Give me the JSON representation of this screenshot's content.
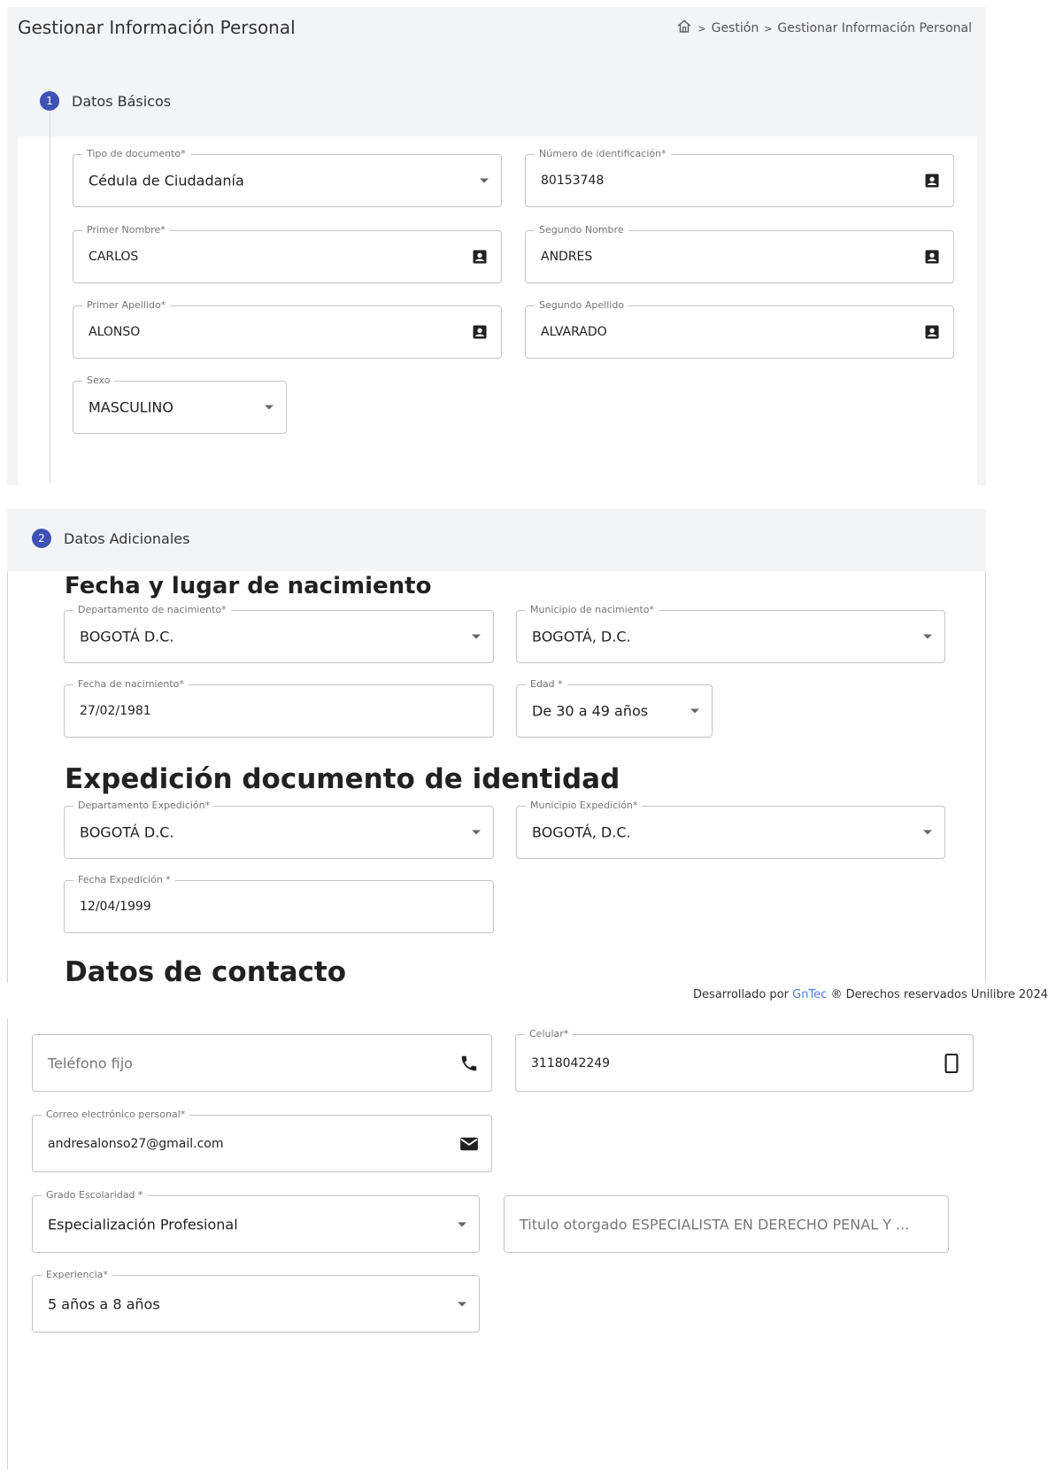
{
  "header": {
    "title": "Gestionar Información Personal",
    "breadcrumb": [
      "Gestión",
      "Gestionar Información Personal"
    ],
    "breadcrumb_sep": ">"
  },
  "step1": {
    "number": "1",
    "label": "Datos Básicos",
    "fields": {
      "tipo_documento": {
        "label": "Tipo de documento*",
        "value": "Cédula de Ciudadanía"
      },
      "numero_identificacion": {
        "label": "Número de identificación*",
        "value": "80153748"
      },
      "primer_nombre": {
        "label": "Primer Nombre*",
        "value": "CARLOS"
      },
      "segundo_nombre": {
        "label": "Segundo Nombre",
        "value": "ANDRES"
      },
      "primer_apellido": {
        "label": "Primer Apellido*",
        "value": "ALONSO"
      },
      "segundo_apellido": {
        "label": "Segundo Apellido",
        "value": "ALVARADO"
      },
      "sexo": {
        "label": "Sexo",
        "value": "MASCULINO"
      }
    }
  },
  "step2": {
    "number": "2",
    "label": "Datos Adicionales",
    "section_nacimiento": "Fecha y lugar de nacimiento",
    "section_expedicion": "Expedición documento de identidad",
    "section_contacto": "Datos de contacto",
    "fields": {
      "depto_nacimiento": {
        "label": "Departamento de nacimiento*",
        "value": "BOGOTÁ D.C."
      },
      "municipio_nacimiento": {
        "label": "Municipio de nacimiento*",
        "value": "BOGOTÁ, D.C."
      },
      "fecha_nacimiento": {
        "label": "Fecha de nacimiento*",
        "value": "27/02/1981"
      },
      "edad": {
        "label": "Edad *",
        "value": "De 30 a 49 años"
      },
      "depto_expedicion": {
        "label": "Departamento Expedición*",
        "value": "BOGOTÁ D.C."
      },
      "municipio_expedicion": {
        "label": "Municipio Expedición*",
        "value": "BOGOTÁ, D.C."
      },
      "fecha_expedicion": {
        "label": "Fecha Expedición *",
        "value": "12/04/1999"
      },
      "telefono_fijo": {
        "placeholder": "Teléfono fijo"
      },
      "celular": {
        "label": "Celular*",
        "value": "3118042249"
      },
      "correo": {
        "label": "Correo electrónico personal*",
        "value": "andresalonso27@gmail.com"
      },
      "grado_escolaridad": {
        "label": "Grado Escolaridad *",
        "value": "Especialización Profesional"
      },
      "titulo_otorgado": {
        "value": "Titulo otorgado ESPECIALISTA EN DERECHO PENAL Y ..."
      },
      "experiencia": {
        "label": "Experiencia*",
        "value": "5 años a 8 años"
      }
    }
  },
  "footer": {
    "prefix": "Desarrollado por",
    "brand": "GnTec",
    "suffix": "® Derechos reservados Unilibre 2024"
  },
  "icons": {
    "home": "home-icon",
    "contact_card": "contact-card-icon",
    "dropdown": "dropdown-caret-icon",
    "phone": "phone-icon",
    "mobile": "mobile-phone-icon",
    "email": "email-icon"
  },
  "colors": {
    "step_badge": "#3f51b5",
    "panel_bg": "#f3f4f6",
    "footer_brand": "#4a7be0"
  }
}
